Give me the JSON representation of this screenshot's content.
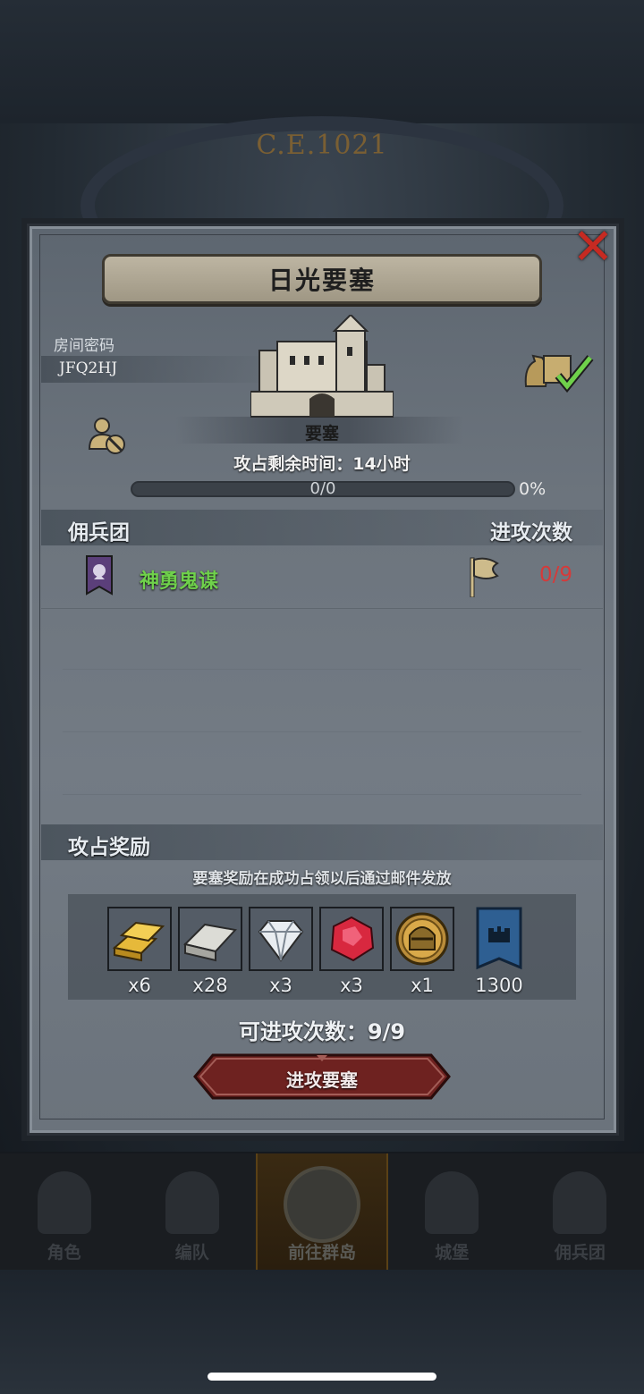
{
  "background": {
    "era_label": "C.E.1021"
  },
  "dialog": {
    "title": "日光要塞",
    "room_label": "房间密码",
    "room_code": "JFQ2HJ",
    "fortress_name": "要塞",
    "timer": "攻占剩余时间：14小时",
    "progress": {
      "text": "0/0",
      "percent_label": "0%",
      "fraction": 0
    },
    "mercenary_header": "佣兵团",
    "attack_count_header": "进攻次数",
    "mercenaries": [
      {
        "name": "神勇鬼谋",
        "attack_count": "0/9"
      }
    ],
    "reward_header": "攻占奖励",
    "reward_note": "要塞奖励在成功占领以后通过邮件发放",
    "rewards": [
      {
        "icon": "gold-bar-icon",
        "qty": "x6"
      },
      {
        "icon": "silver-bar-icon",
        "qty": "x28"
      },
      {
        "icon": "diamond-icon",
        "qty": "x3"
      },
      {
        "icon": "ruby-icon",
        "qty": "x3"
      },
      {
        "icon": "knight-helmet-coin-icon",
        "qty": "x1"
      },
      {
        "icon": "fortress-banner-icon",
        "qty": "1300"
      }
    ],
    "attempts": "可进攻次数：9/9",
    "attack_button": "进攻要塞"
  },
  "nav": {
    "items": [
      {
        "label": "角色",
        "icon": "knight-icon"
      },
      {
        "label": "编队",
        "icon": "helmet-icon"
      },
      {
        "label": "前往群岛",
        "icon": "compass-icon"
      },
      {
        "label": "城堡",
        "icon": "castle-icon"
      },
      {
        "label": "佣兵团",
        "icon": "ship-icon"
      }
    ]
  },
  "colors": {
    "accent_green": "#6fd14b",
    "count_red": "#d53a3a",
    "close_red": "#c62a22"
  }
}
